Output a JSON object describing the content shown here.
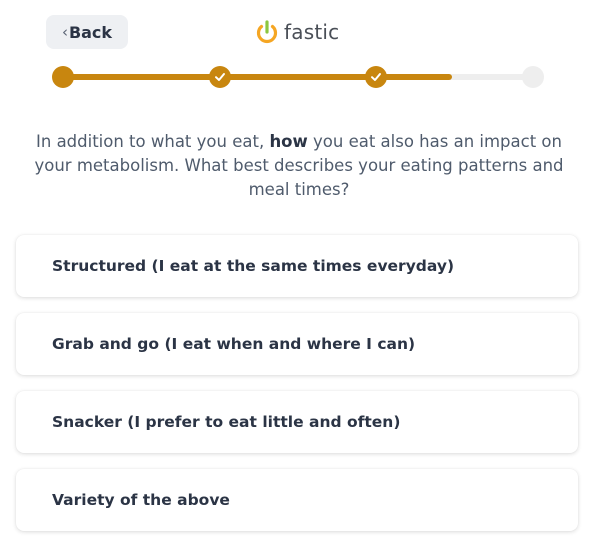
{
  "header": {
    "back_label": "Back",
    "back_chevron": "‹",
    "logo_text": "fastic"
  },
  "progress": {
    "total_steps": 4,
    "completed_steps": 3,
    "fraction_filled": 0.83
  },
  "question": {
    "part1": "In addition to what you eat, ",
    "emphasis": "how",
    "part2": " you eat also has an impact on your metabolism. What best describes your eating patterns and meal times?"
  },
  "options": [
    {
      "label": "Structured (I eat at the same times everyday)"
    },
    {
      "label": "Grab and go (I eat when and where I can)"
    },
    {
      "label": "Snacker (I prefer to eat little and often)"
    },
    {
      "label": "Variety of the above"
    }
  ],
  "colors": {
    "accent": "#c8860f",
    "logo_green": "#8cc63f",
    "logo_orange": "#f5a623",
    "track": "#eeeeee"
  }
}
